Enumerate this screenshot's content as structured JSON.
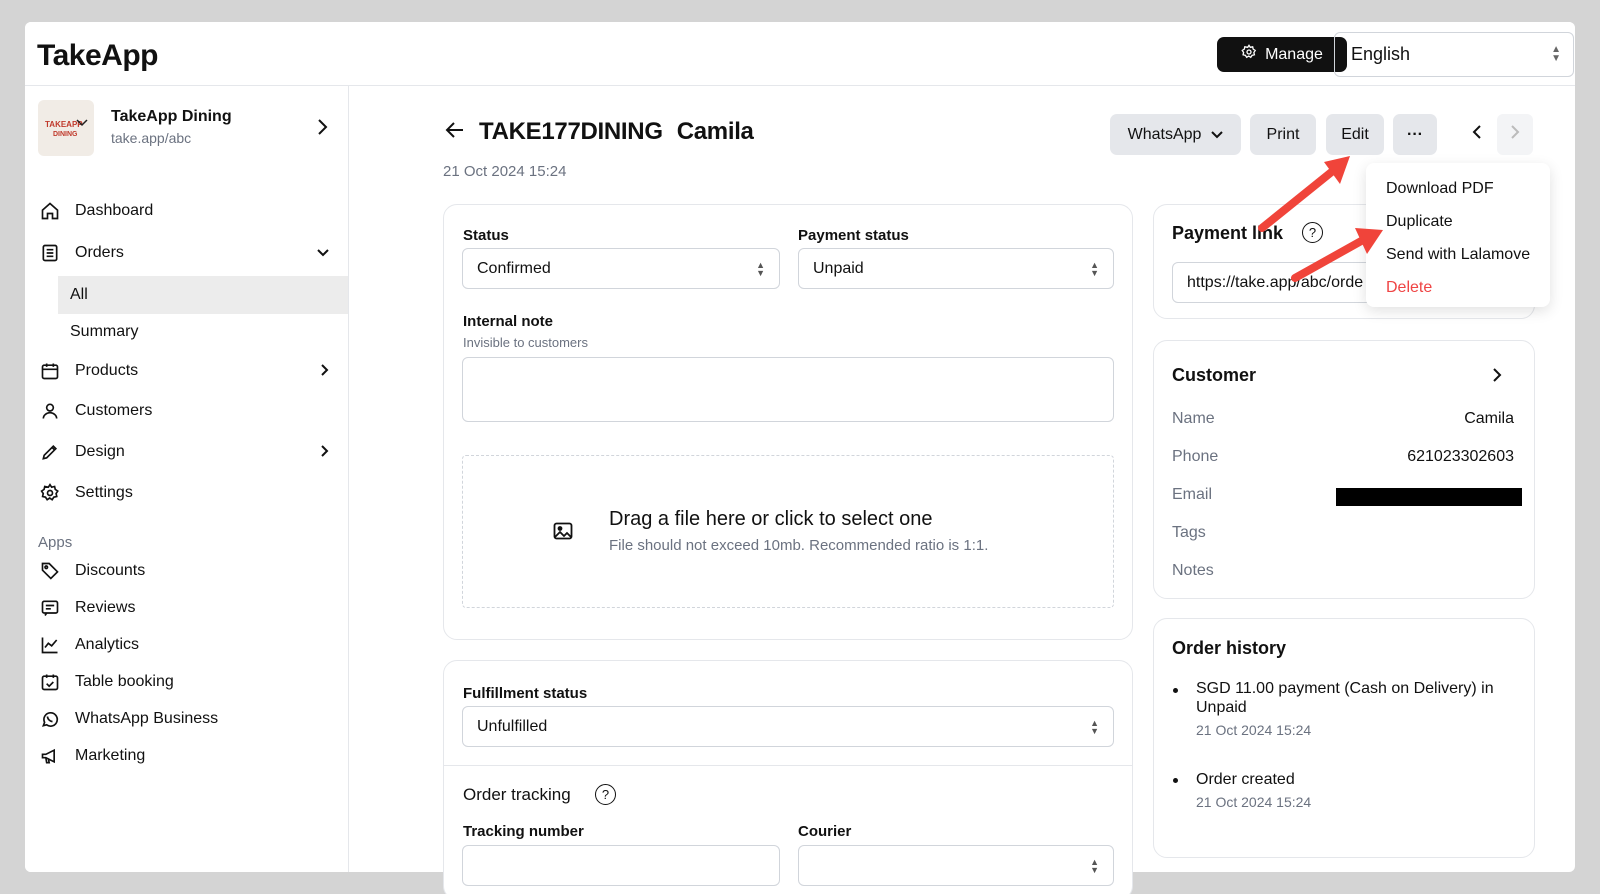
{
  "app": {
    "logo": "TakeApp"
  },
  "topbar": {
    "manage_label": "Manage",
    "language": "English"
  },
  "store": {
    "name": "TakeApp Dining",
    "url": "take.app/abc"
  },
  "sidebar": {
    "items": [
      {
        "label": "Dashboard"
      },
      {
        "label": "Orders"
      },
      {
        "label": "Products"
      },
      {
        "label": "Customers"
      },
      {
        "label": "Design"
      },
      {
        "label": "Settings"
      }
    ],
    "orders_sub": [
      {
        "label": "All"
      },
      {
        "label": "Summary"
      }
    ],
    "apps_label": "Apps",
    "apps": [
      {
        "label": "Discounts"
      },
      {
        "label": "Reviews"
      },
      {
        "label": "Analytics"
      },
      {
        "label": "Table booking"
      },
      {
        "label": "WhatsApp Business"
      },
      {
        "label": "Marketing"
      }
    ]
  },
  "order": {
    "id": "TAKE177DINING",
    "customer_name": "Camila",
    "date": "21 Oct 2024 15:24"
  },
  "actions": {
    "whatsapp": "WhatsApp",
    "print": "Print",
    "edit": "Edit",
    "more": "···"
  },
  "more_menu": {
    "items": [
      {
        "label": "Download PDF"
      },
      {
        "label": "Duplicate"
      },
      {
        "label": "Send with Lalamove"
      },
      {
        "label": "Delete"
      }
    ]
  },
  "status_card": {
    "status_label": "Status",
    "status_value": "Confirmed",
    "payment_label": "Payment status",
    "payment_value": "Unpaid",
    "note_label": "Internal note",
    "note_hint": "Invisible to customers",
    "drop_title": "Drag a file here or click to select one",
    "drop_hint": "File should not exceed 10mb. Recommended ratio is 1:1."
  },
  "fulfillment_card": {
    "status_label": "Fulfillment status",
    "status_value": "Unfulfilled",
    "tracking_label": "Order tracking",
    "tracking_number_label": "Tracking number",
    "courier_label": "Courier"
  },
  "payment_link": {
    "title": "Payment link",
    "url": "https://take.app/abc/orde"
  },
  "customer": {
    "title": "Customer",
    "name_label": "Name",
    "name_value": "Camila",
    "phone_label": "Phone",
    "phone_value": "621023302603",
    "email_label": "Email",
    "tags_label": "Tags",
    "notes_label": "Notes"
  },
  "history": {
    "title": "Order history",
    "items": [
      {
        "text": "SGD 11.00 payment (Cash on Delivery) in",
        "text2": "Unpaid",
        "date": "21 Oct 2024 15:24"
      },
      {
        "text": "Order created",
        "date": "21 Oct 2024 15:24"
      }
    ]
  },
  "colors": {
    "accent_dark": "#111111",
    "danger": "#ef4444",
    "annotation_arrow": "#f0443a"
  }
}
